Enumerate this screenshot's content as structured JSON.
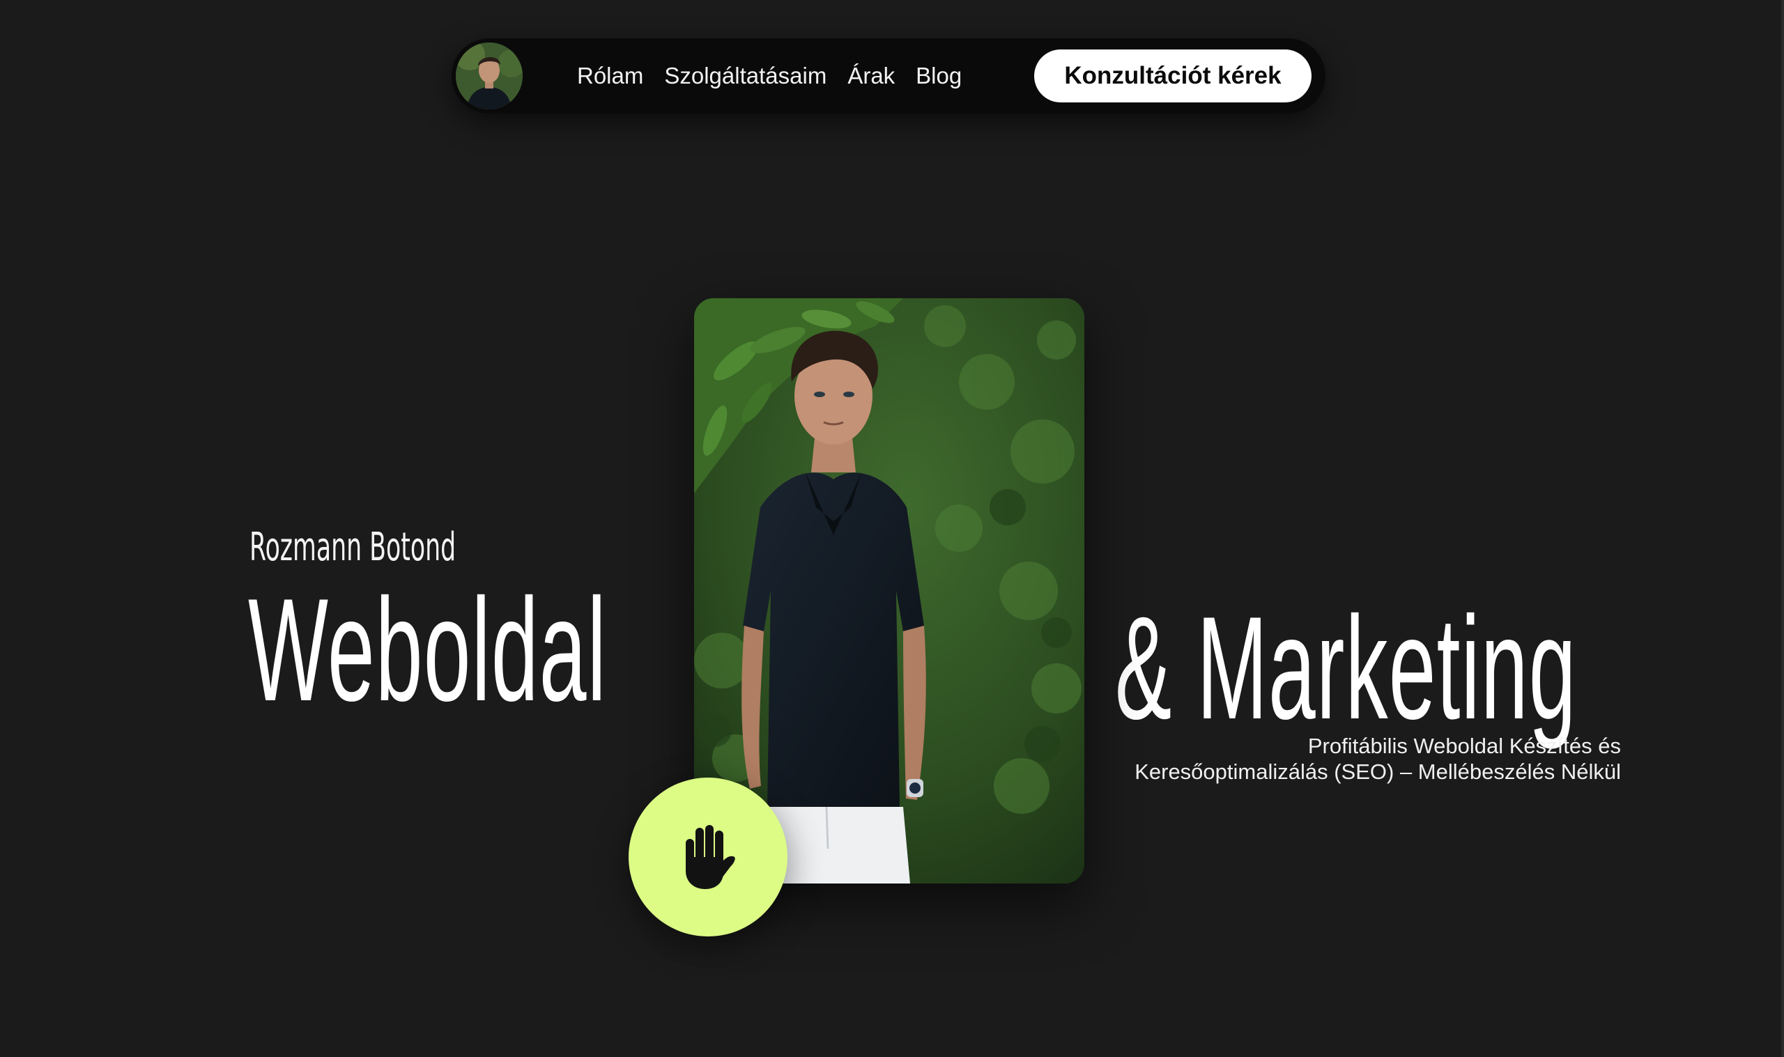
{
  "nav": {
    "avatar_alt": "Rozmann Botond",
    "links": [
      "Rólam",
      "Szolgáltatásaim",
      "Árak",
      "Blog"
    ],
    "cta_label": "Konzultációt kérek"
  },
  "hero": {
    "name": "Rozmann Botond",
    "headline_left": "Weboldal",
    "headline_right": "& Marketing",
    "subtitle_line1": "Profitábilis Weboldal Készítés és",
    "subtitle_line2": "Keresőoptimalizálás (SEO) – Mellébeszélés Nélkül",
    "photo_alt": "Rozmann Botond",
    "wave_icon": "waving-hand-icon"
  },
  "colors": {
    "background": "#1b1b1b",
    "nav_background": "#0a0a0a",
    "accent": "#dcfc86",
    "cta_background": "#ffffff",
    "text": "#ffffff"
  }
}
